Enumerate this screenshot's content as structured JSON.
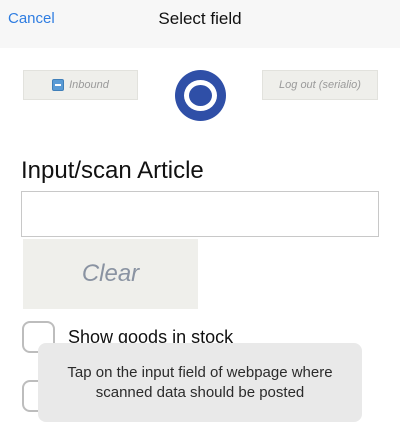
{
  "navbar": {
    "cancel_label": "Cancel",
    "title": "Select field"
  },
  "top_buttons": {
    "inbound_label": "Inbound",
    "inbound_icon": "inbound-icon",
    "logout_label": "Log out (serialio)"
  },
  "logo": {
    "icon": "o-logo-icon",
    "color": "#2f4fa7"
  },
  "form": {
    "field_label": "Input/scan Article",
    "field_value": "",
    "clear_label": "Clear",
    "show_stock_label": "Show goods in stock",
    "show_stock_checked": false,
    "second_option_label": "",
    "second_option_checked": false
  },
  "toast": {
    "message": "Tap on the input field of webpage where scanned data should be posted"
  },
  "colors": {
    "accent": "#2f7de1",
    "button_bg": "#efefeb"
  }
}
